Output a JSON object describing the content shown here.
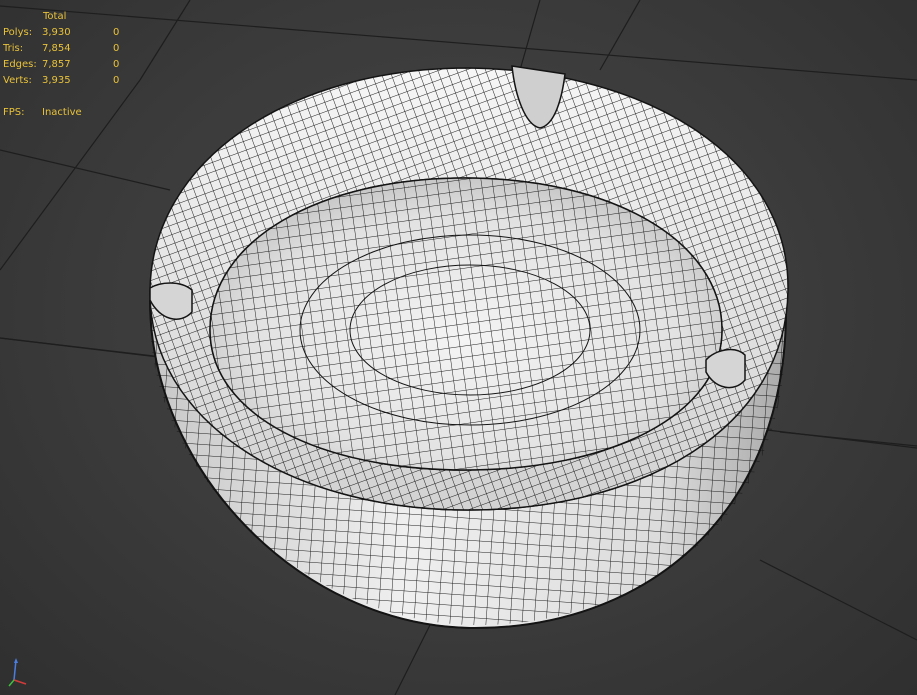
{
  "stats": {
    "header": "Total",
    "rows": [
      {
        "label": "Polys:",
        "total": "3,930",
        "selected": "0"
      },
      {
        "label": "Tris:",
        "total": "7,854",
        "selected": "0"
      },
      {
        "label": "Edges:",
        "total": "7,857",
        "selected": "0"
      },
      {
        "label": "Verts:",
        "total": "3,935",
        "selected": "0"
      }
    ],
    "fps_label": "FPS:",
    "fps_value": "Inactive"
  },
  "viewport": {
    "background": "#3b3b3b",
    "grid_color": "#1e1e1e",
    "model_color": "#e6e6e6",
    "wire_color": "#141414",
    "stats_color": "#e8c23a",
    "axis_icon": "axis-tripod-icon"
  }
}
